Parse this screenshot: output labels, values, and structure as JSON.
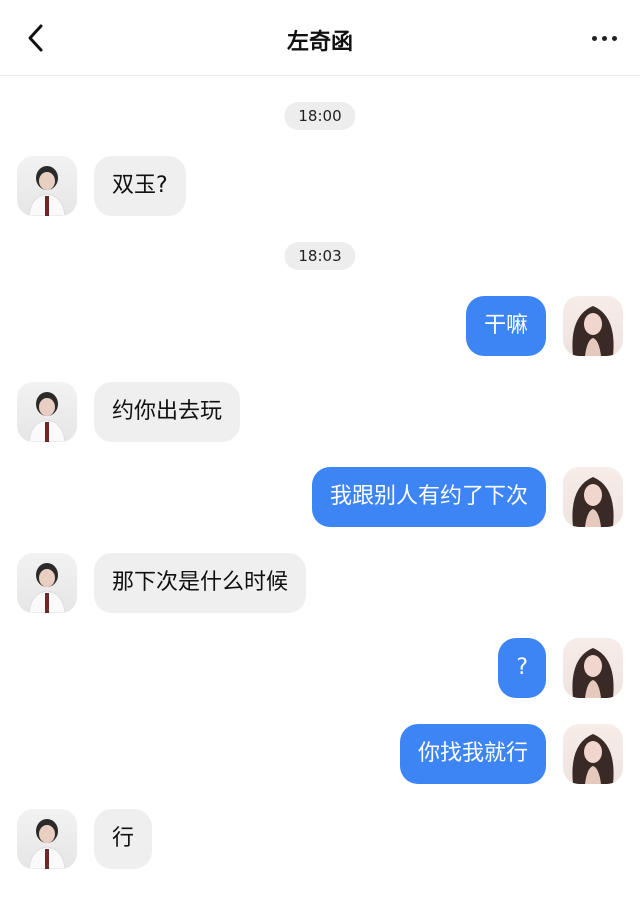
{
  "header": {
    "back_icon": "chevron-left-icon",
    "title": "左奇函",
    "more_icon": "more-horizontal-icon"
  },
  "timestamps": [
    "18:00",
    "18:03"
  ],
  "messages": [
    {
      "side": "left",
      "text": "双玉?"
    },
    {
      "side": "right",
      "text": "干嘛"
    },
    {
      "side": "left",
      "text": "约你出去玩"
    },
    {
      "side": "right",
      "text": "我跟别人有约了下次"
    },
    {
      "side": "left",
      "text": "那下次是什么时候"
    },
    {
      "side": "right",
      "text": "?"
    },
    {
      "side": "right",
      "text": "你找我就行"
    },
    {
      "side": "left",
      "text": "行"
    }
  ],
  "colors": {
    "outgoing_bubble": "#3d84f5",
    "incoming_bubble": "#efefef",
    "timestamp_bg": "#ededed"
  }
}
